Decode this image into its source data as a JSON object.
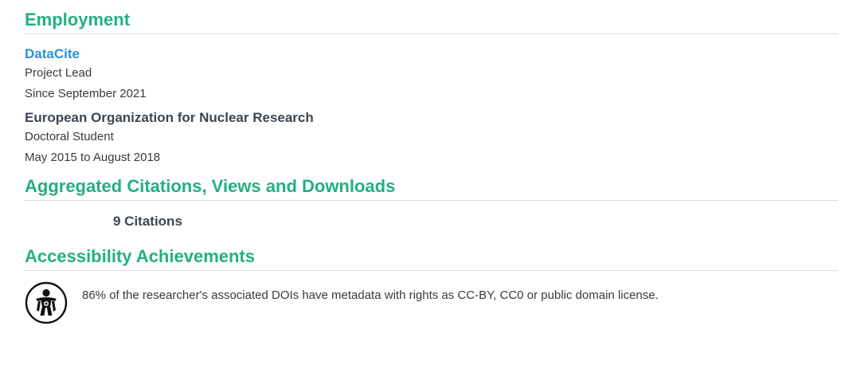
{
  "employment": {
    "title": "Employment",
    "jobs": [
      {
        "organization": "DataCite",
        "role": "Project Lead",
        "period": "Since September 2021"
      },
      {
        "organization": "European Organization for Nuclear Research",
        "role": "Doctoral Student",
        "period": "May 2015 to August 2018"
      }
    ]
  },
  "aggregated": {
    "title": "Aggregated Citations, Views and Downloads",
    "citations": "9 Citations"
  },
  "accessibility": {
    "title": "Accessibility Achievements",
    "badge_icon": "open-access-figure-icon",
    "text": "86% of the researcher's associated DOIs have metadata with rights as CC-BY, CC0 or public domain license."
  },
  "colors": {
    "heading": "#22b083",
    "link": "#2a93d5",
    "text": "#3a3a3a"
  }
}
